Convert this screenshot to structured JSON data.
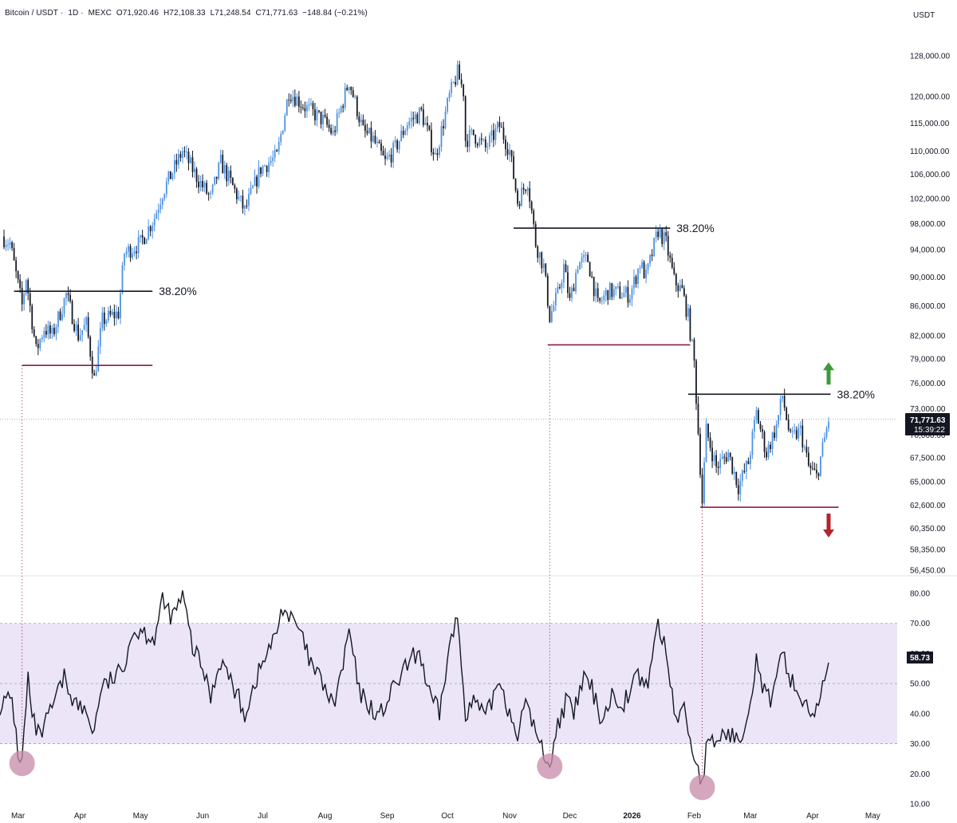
{
  "header": {
    "symbol": "Bitcoin / USDT",
    "interval": "1D",
    "exchange": "MEXC",
    "open": "O71,920.46",
    "high": "H72,108.33",
    "low": "L71,248.54",
    "close": "C71,771.63",
    "change": "−148.84 (−0.21%)"
  },
  "currency_label": "USDT",
  "last_price": {
    "value": "71,771.63",
    "countdown": "15:39:22"
  },
  "rsi_last": "58.73",
  "colors": {
    "bull": "#4a90e2",
    "bear": "#131722",
    "support": "#8b1a4a",
    "fib": "#131722",
    "rsi_band": "#ebe5f7",
    "rsi_marker": "#c58aa8",
    "arrow_up": "#3c9a3c",
    "arrow_down": "#b3232b"
  },
  "chart_data": [
    {
      "type": "candlestick",
      "title": "",
      "x_axis_labels": [
        "Mar",
        "Apr",
        "May",
        "Jun",
        "Jul",
        "Aug",
        "Sep",
        "Oct",
        "Nov",
        "Dec",
        "2026",
        "Feb",
        "Mar",
        "Apr",
        "May"
      ],
      "y_axis_scale": "log",
      "y_ticks": [
        128000,
        120000,
        115000,
        110000,
        106000,
        102000,
        98000,
        94000,
        90000,
        86000,
        82000,
        79000,
        76000,
        73000,
        70000,
        67500,
        65000,
        62600,
        60350,
        58350,
        56450
      ],
      "y_tick_labels": [
        "128,000.00",
        "120,000.00",
        "115,000.00",
        "110,000.00",
        "106,000.00",
        "102,000.00",
        "98,000.00",
        "94,000.00",
        "90,000.00",
        "86,000.00",
        "82,000.00",
        "79,000.00",
        "76,000.00",
        "73,000.00",
        "70,000.00",
        "67,500.00",
        "65,000.00",
        "62,600.00",
        "60,350.00",
        "58,350.00",
        "56,450.00"
      ],
      "price_path": [
        [
          "2025-02-21",
          96000
        ],
        [
          "2025-02-25",
          95000
        ],
        [
          "2025-03-03",
          86000
        ],
        [
          "2025-03-05",
          90000
        ],
        [
          "2025-03-10",
          80000
        ],
        [
          "2025-03-14",
          83000
        ],
        [
          "2025-03-18",
          82000
        ],
        [
          "2025-03-25",
          87500
        ],
        [
          "2025-03-31",
          82000
        ],
        [
          "2025-04-04",
          83500
        ],
        [
          "2025-04-08",
          76500
        ],
        [
          "2025-04-12",
          84000
        ],
        [
          "2025-04-20",
          85000
        ],
        [
          "2025-04-23",
          93500
        ],
        [
          "2025-05-01",
          95000
        ],
        [
          "2025-05-08",
          99000
        ],
        [
          "2025-05-12",
          103000
        ],
        [
          "2025-05-22",
          110000
        ],
        [
          "2025-05-30",
          105000
        ],
        [
          "2025-06-05",
          102000
        ],
        [
          "2025-06-10",
          108000
        ],
        [
          "2025-06-22",
          100000
        ],
        [
          "2025-06-30",
          107000
        ],
        [
          "2025-07-08",
          109000
        ],
        [
          "2025-07-14",
          121000
        ],
        [
          "2025-07-22",
          118000
        ],
        [
          "2025-07-31",
          115500
        ],
        [
          "2025-08-05",
          113000
        ],
        [
          "2025-08-13",
          123000
        ],
        [
          "2025-08-20",
          113500
        ],
        [
          "2025-08-25",
          112000
        ],
        [
          "2025-08-31",
          108000
        ],
        [
          "2025-09-05",
          110500
        ],
        [
          "2025-09-11",
          115000
        ],
        [
          "2025-09-18",
          117000
        ],
        [
          "2025-09-25",
          109000
        ],
        [
          "2025-10-02",
          120000
        ],
        [
          "2025-10-06",
          124500
        ],
        [
          "2025-10-09",
          121000
        ],
        [
          "2025-10-10",
          112000
        ],
        [
          "2025-10-14",
          113000
        ],
        [
          "2025-10-20",
          110500
        ],
        [
          "2025-10-27",
          114500
        ],
        [
          "2025-11-01",
          110000
        ],
        [
          "2025-11-05",
          101500
        ],
        [
          "2025-11-10",
          105000
        ],
        [
          "2025-11-14",
          95000
        ],
        [
          "2025-11-18",
          91500
        ],
        [
          "2025-11-21",
          84500
        ],
        [
          "2025-11-25",
          87500
        ],
        [
          "2025-11-28",
          91500
        ],
        [
          "2025-12-01",
          86500
        ],
        [
          "2025-12-05",
          92000
        ],
        [
          "2025-12-10",
          92500
        ],
        [
          "2025-12-15",
          86000
        ],
        [
          "2025-12-20",
          88000
        ],
        [
          "2025-12-31",
          87500
        ],
        [
          "2026-01-05",
          92000
        ],
        [
          "2026-01-08",
          90000
        ],
        [
          "2026-01-14",
          97000
        ],
        [
          "2026-01-18",
          95000
        ],
        [
          "2026-01-22",
          89500
        ],
        [
          "2026-01-26",
          88000
        ],
        [
          "2026-01-29",
          84500
        ],
        [
          "2026-02-01",
          78500
        ],
        [
          "2026-02-05",
          63000
        ],
        [
          "2026-02-07",
          70500
        ],
        [
          "2026-02-12",
          66500
        ],
        [
          "2026-02-18",
          68000
        ],
        [
          "2026-02-23",
          64500
        ],
        [
          "2026-02-28",
          67000
        ],
        [
          "2026-03-04",
          72500
        ],
        [
          "2026-03-09",
          68000
        ],
        [
          "2026-03-14",
          71000
        ],
        [
          "2026-03-17",
          74500
        ],
        [
          "2026-03-21",
          69500
        ],
        [
          "2026-03-26",
          70500
        ],
        [
          "2026-03-30",
          66500
        ],
        [
          "2026-04-03",
          65500
        ],
        [
          "2026-04-06",
          68500
        ],
        [
          "2026-04-09",
          71772
        ]
      ],
      "last_price": 71771.63,
      "fib_levels": [
        {
          "label": "38.20%",
          "price": 88000,
          "from": "2025-02-27",
          "to": "2025-05-07"
        },
        {
          "label": "38.20%",
          "price": 97300,
          "from": "2025-11-03",
          "to": "2026-01-20"
        },
        {
          "label": "38.20%",
          "price": 74700,
          "from": "2026-01-29",
          "to": "2026-04-10"
        }
      ],
      "support_levels": [
        {
          "price": 78200,
          "from": "2025-03-03",
          "to": "2025-05-07"
        },
        {
          "price": 80800,
          "from": "2025-11-20",
          "to": "2026-01-30"
        },
        {
          "price": 62400,
          "from": "2026-02-04",
          "to": "2026-04-14"
        }
      ]
    },
    {
      "type": "line",
      "title": "",
      "ylim": [
        10,
        85
      ],
      "y_ticks": [
        80,
        70,
        60,
        50,
        40,
        30,
        20,
        10
      ],
      "y_tick_labels": [
        "80.00",
        "70.00",
        "60.00",
        "50.00",
        "40.00",
        "30.00",
        "20.00",
        "10.00"
      ],
      "band": [
        30,
        70
      ],
      "midline": 50,
      "rsi_path": [
        [
          "2025-02-20",
          43
        ],
        [
          "2025-02-26",
          45
        ],
        [
          "2025-03-01",
          27
        ],
        [
          "2025-03-03",
          24
        ],
        [
          "2025-03-06",
          52
        ],
        [
          "2025-03-08",
          38
        ],
        [
          "2025-03-12",
          32
        ],
        [
          "2025-03-18",
          42
        ],
        [
          "2025-03-24",
          52
        ],
        [
          "2025-03-29",
          44
        ],
        [
          "2025-04-04",
          40
        ],
        [
          "2025-04-08",
          34
        ],
        [
          "2025-04-11",
          48
        ],
        [
          "2025-04-18",
          52
        ],
        [
          "2025-04-22",
          54
        ],
        [
          "2025-04-26",
          66
        ],
        [
          "2025-05-01",
          68
        ],
        [
          "2025-05-08",
          65
        ],
        [
          "2025-05-12",
          77
        ],
        [
          "2025-05-17",
          72
        ],
        [
          "2025-05-22",
          79
        ],
        [
          "2025-05-27",
          62
        ],
        [
          "2025-06-01",
          55
        ],
        [
          "2025-06-05",
          46
        ],
        [
          "2025-06-10",
          58
        ],
        [
          "2025-06-15",
          51
        ],
        [
          "2025-06-22",
          40
        ],
        [
          "2025-06-28",
          52
        ],
        [
          "2025-07-03",
          60
        ],
        [
          "2025-07-07",
          65
        ],
        [
          "2025-07-11",
          76
        ],
        [
          "2025-07-14",
          72
        ],
        [
          "2025-07-19",
          68
        ],
        [
          "2025-07-25",
          56
        ],
        [
          "2025-07-31",
          50
        ],
        [
          "2025-08-05",
          42
        ],
        [
          "2025-08-10",
          56
        ],
        [
          "2025-08-13",
          68
        ],
        [
          "2025-08-18",
          47
        ],
        [
          "2025-08-24",
          42
        ],
        [
          "2025-08-28",
          39
        ],
        [
          "2025-09-04",
          48
        ],
        [
          "2025-09-11",
          56
        ],
        [
          "2025-09-17",
          61
        ],
        [
          "2025-09-22",
          46
        ],
        [
          "2025-09-27",
          40
        ],
        [
          "2025-10-02",
          62
        ],
        [
          "2025-10-06",
          72
        ],
        [
          "2025-10-10",
          41
        ],
        [
          "2025-10-15",
          44
        ],
        [
          "2025-10-20",
          38
        ],
        [
          "2025-10-27",
          52
        ],
        [
          "2025-11-01",
          40
        ],
        [
          "2025-11-05",
          34
        ],
        [
          "2025-11-10",
          44
        ],
        [
          "2025-11-14",
          33
        ],
        [
          "2025-11-18",
          27
        ],
        [
          "2025-11-21",
          23
        ],
        [
          "2025-11-25",
          36
        ],
        [
          "2025-11-29",
          44
        ],
        [
          "2025-12-03",
          40
        ],
        [
          "2025-12-08",
          52
        ],
        [
          "2025-12-12",
          48
        ],
        [
          "2025-12-17",
          38
        ],
        [
          "2025-12-22",
          46
        ],
        [
          "2025-12-28",
          44
        ],
        [
          "2026-01-04",
          53
        ],
        [
          "2026-01-08",
          48
        ],
        [
          "2026-01-14",
          70
        ],
        [
          "2026-01-18",
          60
        ],
        [
          "2026-01-23",
          38
        ],
        [
          "2026-01-27",
          42
        ],
        [
          "2026-01-31",
          28
        ],
        [
          "2026-02-03",
          22
        ],
        [
          "2026-02-05",
          16
        ],
        [
          "2026-02-07",
          28
        ],
        [
          "2026-02-12",
          31
        ],
        [
          "2026-02-18",
          34
        ],
        [
          "2026-02-23",
          30
        ],
        [
          "2026-02-28",
          42
        ],
        [
          "2026-03-04",
          58
        ],
        [
          "2026-03-08",
          47
        ],
        [
          "2026-03-12",
          44
        ],
        [
          "2026-03-17",
          60
        ],
        [
          "2026-03-21",
          52
        ],
        [
          "2026-03-26",
          45
        ],
        [
          "2026-03-30",
          42
        ],
        [
          "2026-04-03",
          40
        ],
        [
          "2026-04-06",
          48
        ],
        [
          "2026-04-09",
          59
        ]
      ],
      "last_value": 58.73,
      "oversold_markers": [
        "2025-03-03",
        "2025-11-21",
        "2026-02-05"
      ]
    }
  ]
}
